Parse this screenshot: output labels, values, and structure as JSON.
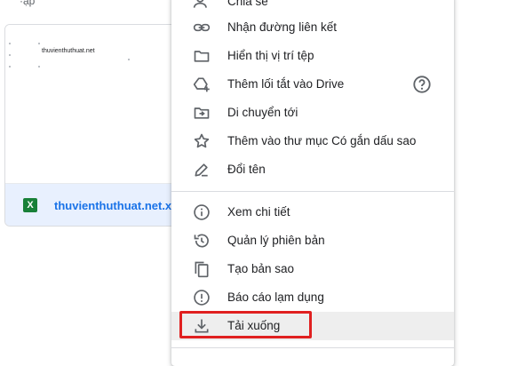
{
  "background_top_text": "·ập",
  "file_card": {
    "thumbnail_text": "thuvienthuthuat.net",
    "file_icon_letter": "X",
    "file_name": "thuvienthuthuat.net.xlsx"
  },
  "menu": {
    "items": [
      {
        "label": "Chia sẻ",
        "icon": "person-add-icon"
      },
      {
        "label": "Nhận đường liên kết",
        "icon": "link-icon"
      },
      {
        "label": "Hiển thị vị trí tệp",
        "icon": "folder-icon"
      },
      {
        "label": "Thêm lối tắt vào Drive",
        "icon": "add-shortcut-icon"
      },
      {
        "label": "Di chuyển tới",
        "icon": "move-to-icon"
      },
      {
        "label": "Thêm vào thư mục Có gắn dấu sao",
        "icon": "star-icon"
      },
      {
        "label": "Đổi tên",
        "icon": "pencil-icon"
      },
      {
        "label": "Xem chi tiết",
        "icon": "info-icon"
      },
      {
        "label": "Quản lý phiên bản",
        "icon": "history-icon"
      },
      {
        "label": "Tạo bản sao",
        "icon": "copy-icon"
      },
      {
        "label": "Báo cáo lạm dụng",
        "icon": "report-icon"
      },
      {
        "label": "Tải xuống",
        "icon": "download-icon"
      }
    ]
  },
  "colors": {
    "highlight_border": "#e02020",
    "file_name": "#1a73e8",
    "excel_green": "#188038"
  }
}
